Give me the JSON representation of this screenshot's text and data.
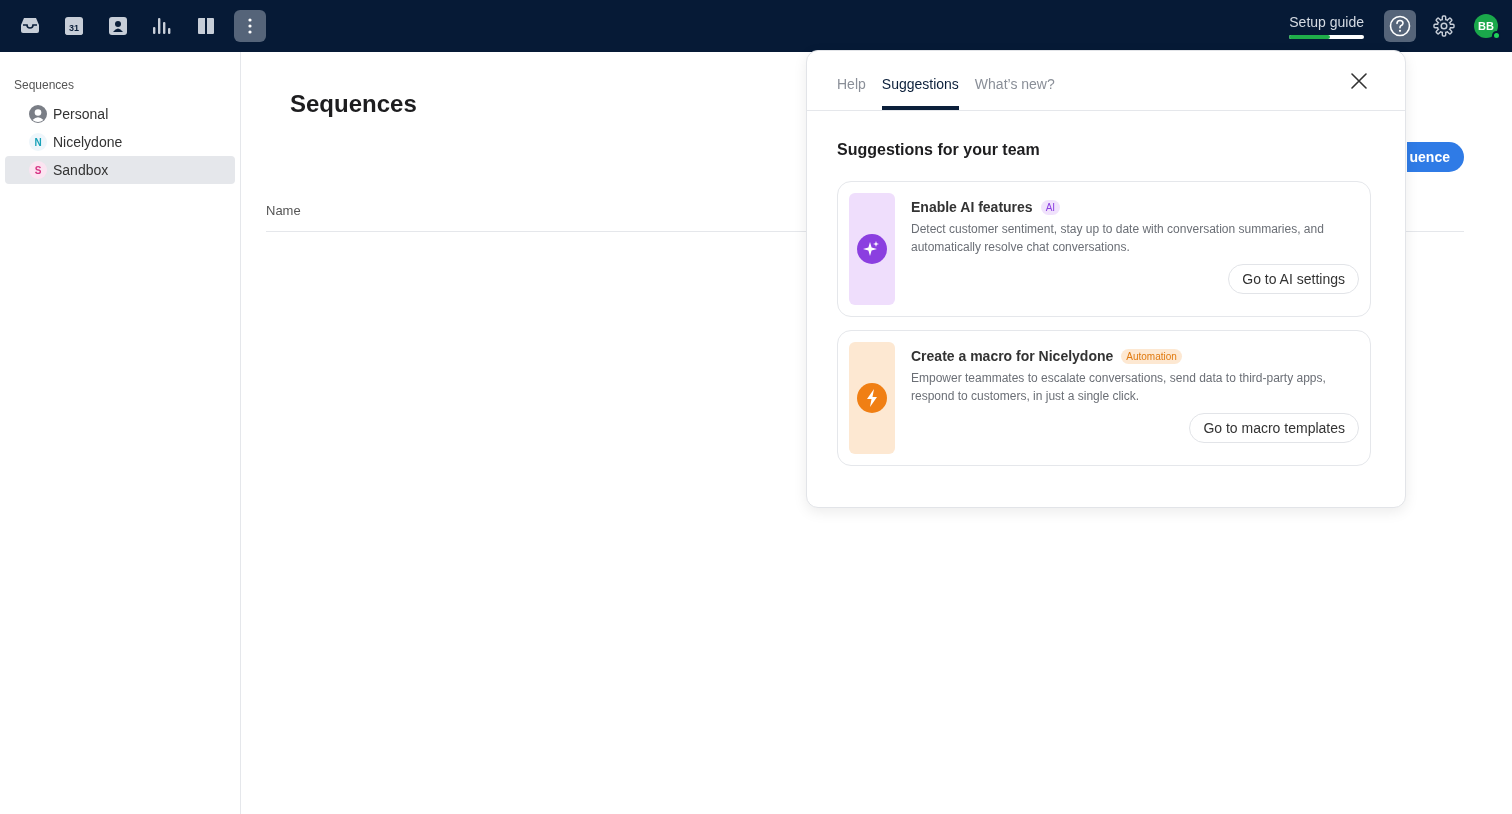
{
  "topbar": {
    "apps": [
      {
        "kind": "inbox",
        "selected": false
      },
      {
        "kind": "calendar",
        "label": "31",
        "selected": false
      },
      {
        "kind": "contact",
        "selected": false
      },
      {
        "kind": "chart",
        "selected": false
      },
      {
        "kind": "book",
        "selected": false
      },
      {
        "kind": "more",
        "selected": true
      }
    ],
    "setup_guide": {
      "label": "Setup guide",
      "level": 0.54
    },
    "help_selected": true,
    "avatar": {
      "initials": "BB",
      "online": true
    }
  },
  "sidebar": {
    "heading": "Sequences",
    "items": [
      {
        "kind": "user",
        "label": "Personal",
        "selected": false
      },
      {
        "kind": "letter",
        "letter": "N",
        "label": "Nicelydone",
        "color": "#17a2b8",
        "selected": false
      },
      {
        "kind": "letter",
        "letter": "S",
        "label": "Sandbox",
        "color": "#d63384",
        "selected": true
      }
    ]
  },
  "main": {
    "title": "Sequences",
    "button": "uence",
    "columns": [
      "Name"
    ]
  },
  "panel": {
    "tabs": [
      {
        "label": "Help",
        "selected": false
      },
      {
        "label": "Suggestions",
        "selected": true
      },
      {
        "label": "What’s new?",
        "selected": false
      }
    ],
    "heading": "Suggestions for your team",
    "cards": [
      {
        "kind": "ai",
        "title": "Enable AI features",
        "tag": "AI",
        "description": "Detect customer sentiment, stay up to date with conversation summaries, and automatically resolve chat conversations.",
        "action": "Go to AI settings"
      },
      {
        "kind": "automation",
        "title": "Create a macro for Nicelydone",
        "tag": "Automation",
        "description": "Empower teammates to escalate conversations, send data to third-party apps, respond to customers, in just a single click.",
        "action": "Go to macro templates"
      }
    ]
  }
}
